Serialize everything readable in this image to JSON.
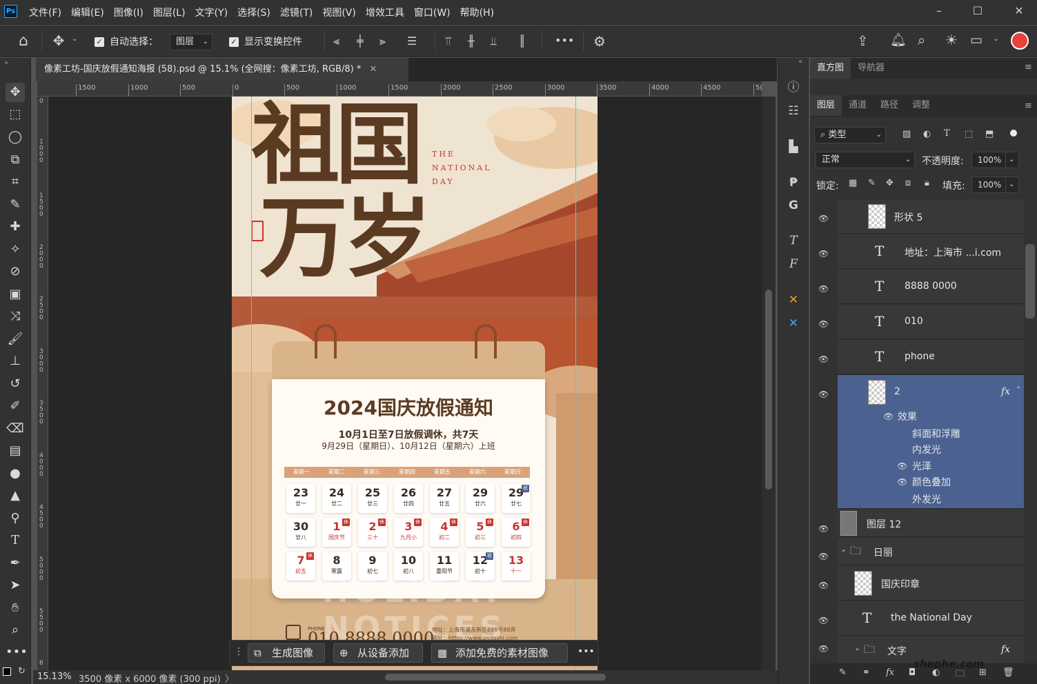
{
  "app": {
    "logo": "Ps"
  },
  "menu": [
    "文件(F)",
    "编辑(E)",
    "图像(I)",
    "图层(L)",
    "文字(Y)",
    "选择(S)",
    "滤镜(T)",
    "视图(V)",
    "增效工具",
    "窗口(W)",
    "帮助(H)"
  ],
  "window_controls": {
    "minimize": "–",
    "maximize": "☐",
    "close": "✕"
  },
  "options": {
    "auto_select_label": "自动选择：",
    "auto_select_value": "图层",
    "show_transform_label": "显示变换控件",
    "more": "•••"
  },
  "document_tab": {
    "title": "像素工坊-国庆放假通知海报 (58).psd @ 15.1% (全网搜：像素工坊, RGB/8) *",
    "close": "✕"
  },
  "ruler": {
    "h_ticks": [
      "1500",
      "1000",
      "500",
      "0",
      "500",
      "1000",
      "1500",
      "2000",
      "2500",
      "3000",
      "3500",
      "4000",
      "4500",
      "5("
    ],
    "v_ticks": [
      "0",
      "1000",
      "1500",
      "2000",
      "2500",
      "3000",
      "3500",
      "4000",
      "4500",
      "5000",
      "5500",
      "6"
    ]
  },
  "status": {
    "zoom": "15.13%",
    "doc_info": "3500 像素 x 6000 像素 (300 ppi)",
    "arrow": "〉"
  },
  "context_bar": {
    "generate": "生成图像",
    "from_device": "从设备添加",
    "free_assets": "添加免费的素材图像",
    "more": "•••"
  },
  "poster": {
    "title_line1": "祖国",
    "title_line2": "万岁",
    "english_lines": [
      "THE",
      "NATIONAL",
      "DAY"
    ],
    "heading": "2024国庆放假通知",
    "sub1": "10月1日至7日放假调休，共7天",
    "sub2": "9月29日（星期日）、10月12日（星期六）上班",
    "weekdays": [
      "星期一",
      "星期二",
      "星期三",
      "星期四",
      "星期五",
      "星期六",
      "星期日"
    ],
    "rows": [
      [
        {
          "n": "23",
          "l": "廿一"
        },
        {
          "n": "24",
          "l": "廿二"
        },
        {
          "n": "25",
          "l": "廿三"
        },
        {
          "n": "26",
          "l": "廿四"
        },
        {
          "n": "27",
          "l": "廿五"
        },
        {
          "n": "29",
          "l": "廿六"
        },
        {
          "n": "29",
          "l": "廿七",
          "tag": "班"
        }
      ],
      [
        {
          "n": "30",
          "l": "廿八"
        },
        {
          "n": "1",
          "l": "国庆节",
          "red": true,
          "tag": "休"
        },
        {
          "n": "2",
          "l": "三十",
          "red": true,
          "tag": "休"
        },
        {
          "n": "3",
          "l": "九月小",
          "red": true,
          "tag": "休"
        },
        {
          "n": "4",
          "l": "初二",
          "red": true,
          "tag": "休"
        },
        {
          "n": "5",
          "l": "初三",
          "red": true,
          "tag": "休"
        },
        {
          "n": "6",
          "l": "初四",
          "red": true,
          "tag": "休"
        }
      ],
      [
        {
          "n": "7",
          "l": "初五",
          "red": true,
          "tag": "休"
        },
        {
          "n": "8",
          "l": "寒露"
        },
        {
          "n": "9",
          "l": "初七"
        },
        {
          "n": "10",
          "l": "初八"
        },
        {
          "n": "11",
          "l": "重阳节"
        },
        {
          "n": "12",
          "l": "初十",
          "tag": "班"
        },
        {
          "n": "13",
          "l": "十一",
          "red": true
        }
      ]
    ],
    "phone_label": "PHONE",
    "phone": "010 8888 0000",
    "address": "地址：上海市浦东新区888号88弄",
    "web": "网址：https://www.psdashi.com",
    "watermark_bg": "HOLIDAY NOTICES"
  },
  "panel": {
    "tabs_top": [
      "直方图",
      "导航器"
    ],
    "tabs_layers": [
      "图层",
      "通道",
      "路径",
      "调整"
    ],
    "filter_label": "类型",
    "blend_mode": "正常",
    "opacity_label": "不透明度:",
    "opacity": "100%",
    "lock_label": "锁定:",
    "fill_label": "填充:",
    "fill": "100%",
    "layers": [
      {
        "name": "形状 5",
        "kind": "shape"
      },
      {
        "name": "地址：上海市 ...i.com",
        "kind": "text"
      },
      {
        "name": "8888 0000",
        "kind": "text-warp"
      },
      {
        "name": "010",
        "kind": "text-warp"
      },
      {
        "name": "phone",
        "kind": "text-warp"
      },
      {
        "name": "2",
        "kind": "pixel",
        "fx": "fx"
      },
      {
        "name": "图层 12",
        "kind": "pixel"
      },
      {
        "name": "日丽",
        "kind": "group"
      },
      {
        "name": "国庆印章",
        "kind": "pixel"
      },
      {
        "name": "the National Day",
        "kind": "text-warp"
      },
      {
        "name": "文字",
        "kind": "group",
        "fx": "fx"
      }
    ],
    "effects_label": "效果",
    "effects": [
      "斜面和浮雕",
      "内发光",
      "光泽",
      "颜色叠加",
      "外发光"
    ],
    "site_watermark": "shephe.com"
  },
  "colors": {
    "ui_bg": "#323232",
    "selected_layer": "#4b6291",
    "poster_brown": "#5a3b22",
    "calendar_red": "#c8342c"
  }
}
